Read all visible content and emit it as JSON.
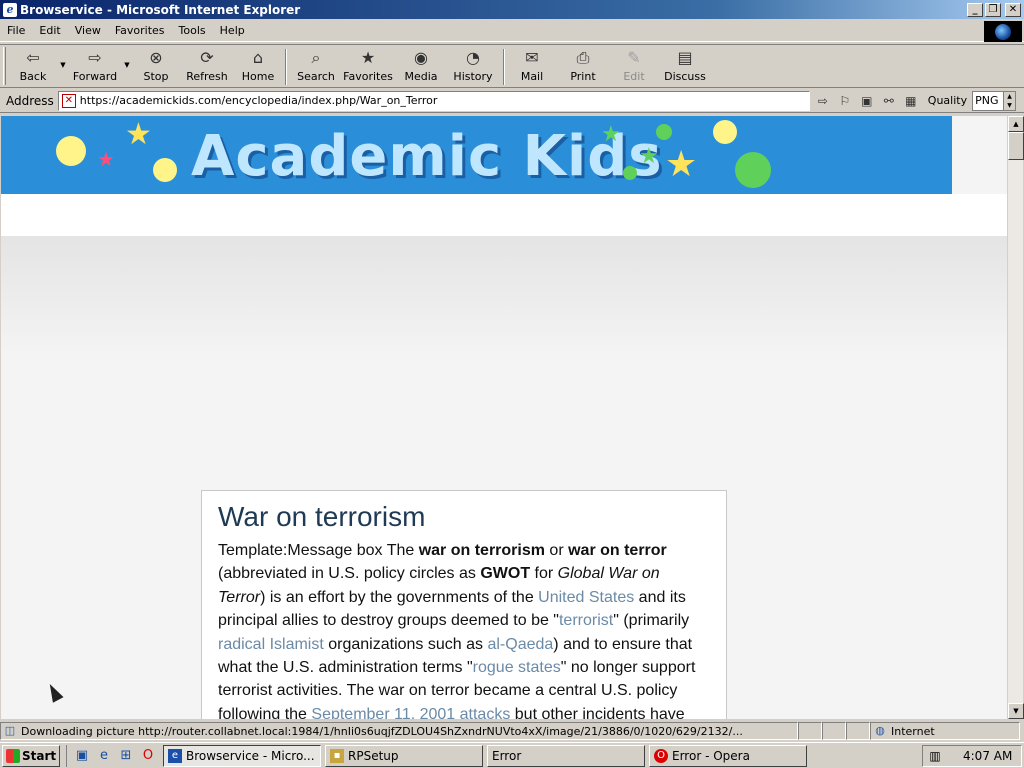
{
  "window": {
    "title": "Browservice - Microsoft Internet Explorer",
    "controls": {
      "minimize": "_",
      "maximize": "❐",
      "close": "✕"
    }
  },
  "menu": [
    "File",
    "Edit",
    "View",
    "Favorites",
    "Tools",
    "Help"
  ],
  "toolbar": {
    "back": "Back",
    "forward": "Forward",
    "stop": "Stop",
    "refresh": "Refresh",
    "home": "Home",
    "search": "Search",
    "favorites": "Favorites",
    "media": "Media",
    "history": "History",
    "mail": "Mail",
    "print": "Print",
    "edit": "Edit",
    "discuss": "Discuss"
  },
  "address": {
    "label": "Address",
    "url": "https://academickids.com/encyclopedia/index.php/War_on_Terror",
    "quality_label": "Quality",
    "quality_value": "PNG"
  },
  "page": {
    "banner_title": "Academic Kids",
    "article_title": "War on terrorism",
    "p_template": "Template:Message box The ",
    "p_bold1": "war on terrorism",
    "p_or": " or ",
    "p_bold2": "war on terror",
    "p_abbrev": " (abbreviated in U.S. policy circles as ",
    "p_gwot": "GWOT",
    "p_for": " for ",
    "p_italic": "Global War on Terror",
    "p_effort": ") is an effort by the governments of the ",
    "link_us": "United States",
    "p_allies": " and its principal allies to destroy groups deemed to be \"",
    "link_terrorist": "terrorist",
    "p_primarily": "\" (primarily ",
    "link_islamist": "radical Islamist",
    "p_orgs": " organizations such as ",
    "link_alqaeda": "al-Qaeda",
    "p_ensure": ") and to ensure that what the U.S. administration terms \"",
    "link_rogue": "rogue states",
    "p_nolonger": "\" no longer support terrorist activities. The war on terror became a central U.S. policy following the ",
    "link_sept11": "September 11, 2001 attacks",
    "p_other": " but other incidents have been cited as"
  },
  "status": {
    "text": "Downloading picture http://router.collabnet.local:1984/1/hnIi0s6uqjfZDLOU4ShZxndrNUVto4xX/image/21/3886/0/1020/629/2132/...",
    "zone": "Internet"
  },
  "taskbar": {
    "start": "Start",
    "tasks": [
      "Browservice - Micro...",
      "RPSetup",
      "Error",
      "Error - Opera"
    ],
    "clock": "4:07 AM"
  }
}
